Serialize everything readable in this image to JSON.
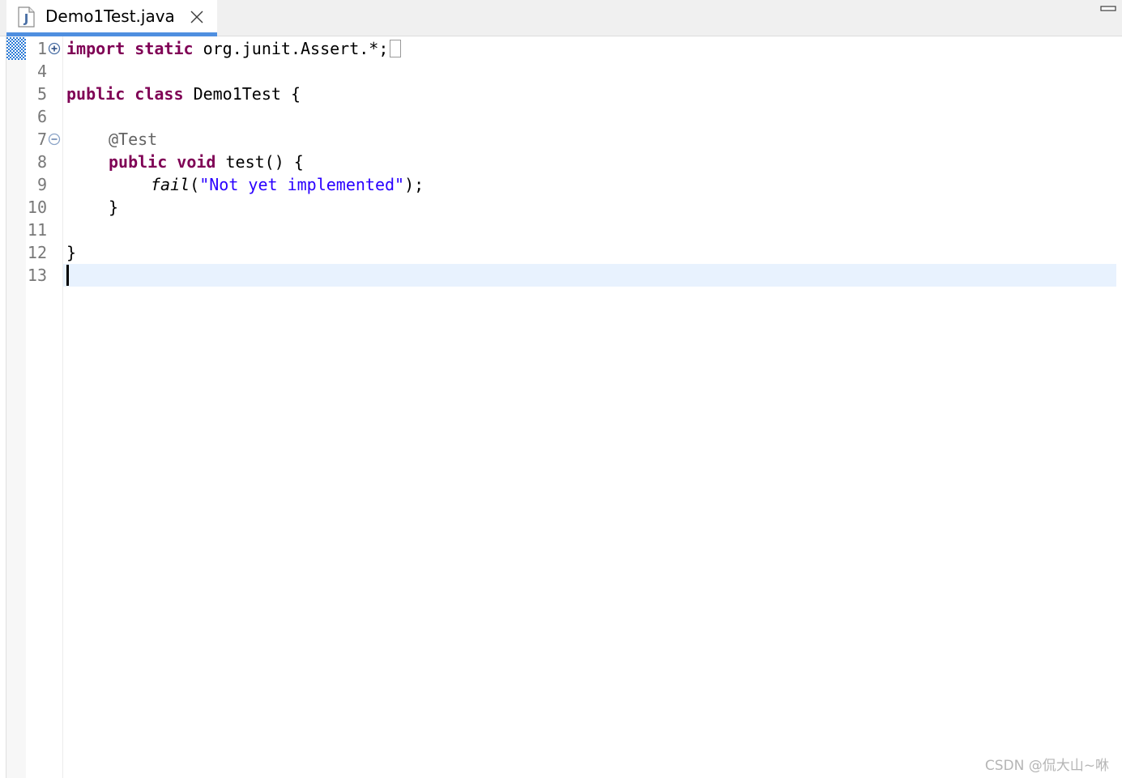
{
  "tab": {
    "title": "Demo1Test.java",
    "icon": "java-file-icon",
    "icon_letter": "J"
  },
  "editor": {
    "lines": [
      {
        "number": "1",
        "fold": "expand"
      },
      {
        "number": "4"
      },
      {
        "number": "5"
      },
      {
        "number": "6"
      },
      {
        "number": "7",
        "fold": "collapse"
      },
      {
        "number": "8"
      },
      {
        "number": "9"
      },
      {
        "number": "10"
      },
      {
        "number": "11"
      },
      {
        "number": "12"
      },
      {
        "number": "13",
        "current": true
      }
    ],
    "code": {
      "l1_kw1": "import",
      "l1_kw2": "static",
      "l1_rest": "org.junit.Assert.*;",
      "l5_kw1": "public",
      "l5_kw2": "class",
      "l5_rest": "Demo1Test {",
      "l7_annotation": "@Test",
      "l8_kw1": "public",
      "l8_kw2": "void",
      "l8_rest": "test() {",
      "l9_method": "fail",
      "l9_open": "(",
      "l9_string": "\"Not yet implemented\"",
      "l9_close": ");",
      "l10": "}",
      "l12": "}"
    }
  },
  "watermark": "CSDN @侃大山~咻",
  "colors": {
    "keyword": "#7f0055",
    "string": "#2a00ff",
    "annotation": "#646464",
    "current_line": "#e8f2fe",
    "tab_accent": "#4f8fe0"
  }
}
